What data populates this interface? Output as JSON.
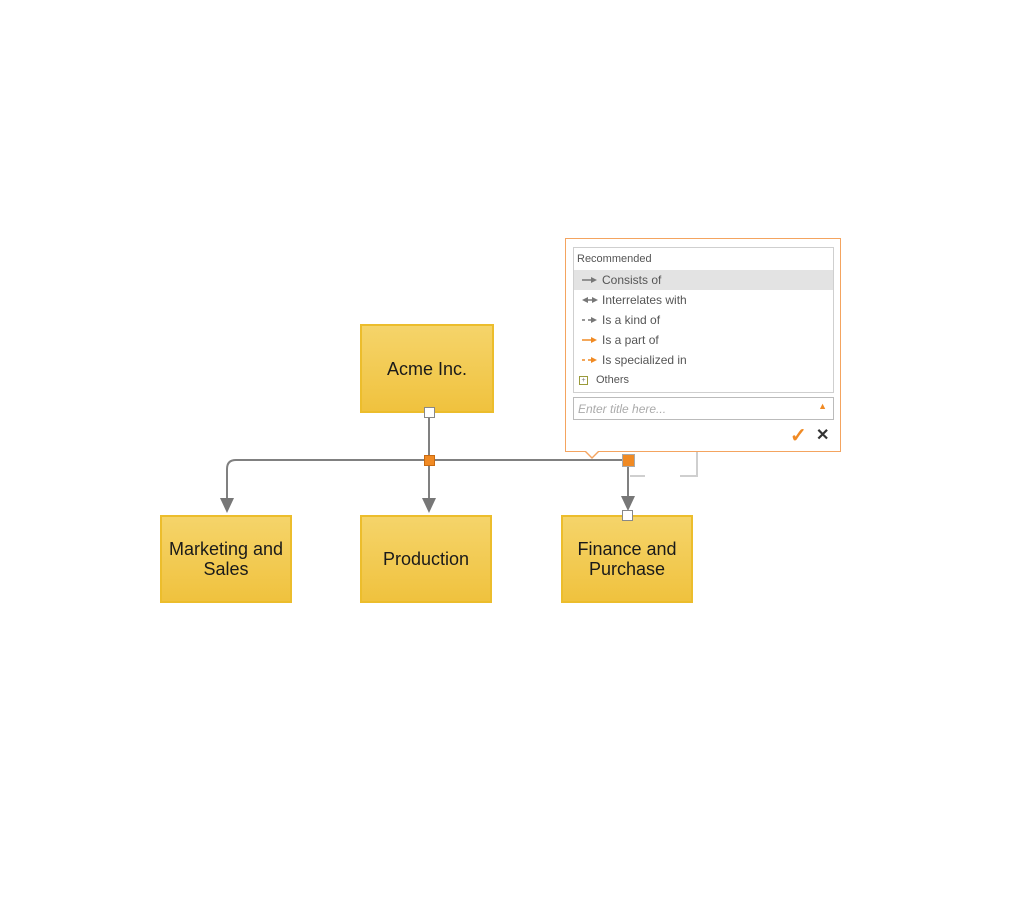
{
  "nodes": {
    "root": "Acme Inc.",
    "marketing": "Marketing and Sales",
    "production": "Production",
    "finance": "Finance and Purchase"
  },
  "popup": {
    "section_label": "Recommended",
    "items": [
      {
        "label": "Consists of",
        "icon": "solid-arrow-icon",
        "selected": true
      },
      {
        "label": "Interrelates with",
        "icon": "double-arrow-icon"
      },
      {
        "label": "Is a kind of",
        "icon": "dashed-arrow-icon"
      },
      {
        "label": "Is a part of",
        "icon": "orange-arrow-icon"
      },
      {
        "label": "Is specialized in",
        "icon": "orange-dashed-arrow-icon"
      }
    ],
    "others_label": "Others",
    "title_placeholder": "Enter title here...",
    "confirm_icon": "checkmark-icon",
    "cancel_icon": "close-icon"
  },
  "colors": {
    "node_fill": "#f0c23e",
    "accent": "#f08a24",
    "connector": "#808080"
  }
}
